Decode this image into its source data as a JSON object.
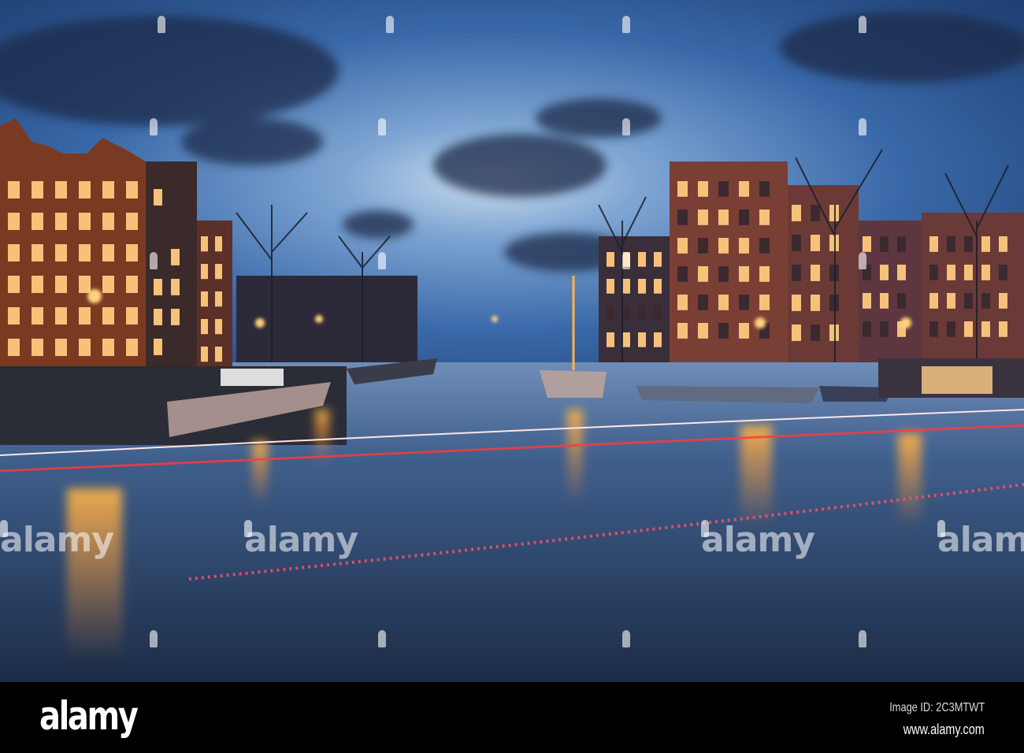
{
  "watermark": {
    "text": "alamy"
  },
  "footer": {
    "logo": "alamy",
    "image_id": "Image ID: 2C3MTWT",
    "website": "www.alamy.com"
  },
  "colors": {
    "sky_top": "#1d3d6e",
    "sky_horizon": "#9fc0e0",
    "water": "#2a4466",
    "lamp": "#ffb347",
    "trail": "#ff3a3a"
  }
}
